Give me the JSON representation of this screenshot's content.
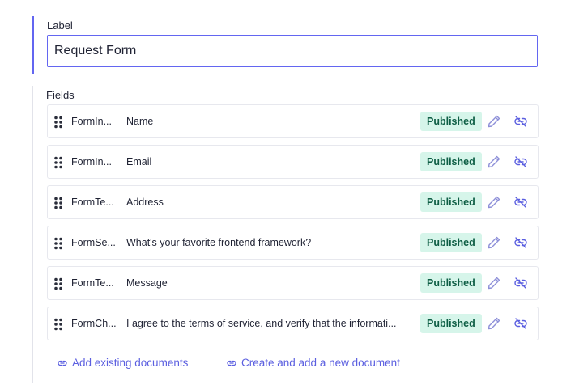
{
  "label_section": {
    "title": "Label",
    "input_value": "Request Form"
  },
  "fields_section": {
    "title": "Fields",
    "items": [
      {
        "type": "FormIn...",
        "name": "Name",
        "status": "Published"
      },
      {
        "type": "FormIn...",
        "name": "Email",
        "status": "Published"
      },
      {
        "type": "FormTe...",
        "name": "Address",
        "status": "Published"
      },
      {
        "type": "FormSe...",
        "name": "What's your favorite frontend framework?",
        "status": "Published"
      },
      {
        "type": "FormTe...",
        "name": "Message",
        "status": "Published"
      },
      {
        "type": "FormCh...",
        "name": "I agree to the terms of service, and verify that the informati...",
        "status": "Published"
      }
    ]
  },
  "actions": {
    "add_existing": "Add existing documents",
    "create_new": "Create and add a new document"
  },
  "icons": {
    "drag": "drag-handle-icon",
    "edit": "pencil-icon",
    "unlink": "unlink-icon",
    "link": "link-icon"
  },
  "colors": {
    "accent": "#6366f1",
    "link": "#5b5fe0",
    "badge_bg": "#d6f5ea",
    "badge_text": "#0e5e45"
  }
}
